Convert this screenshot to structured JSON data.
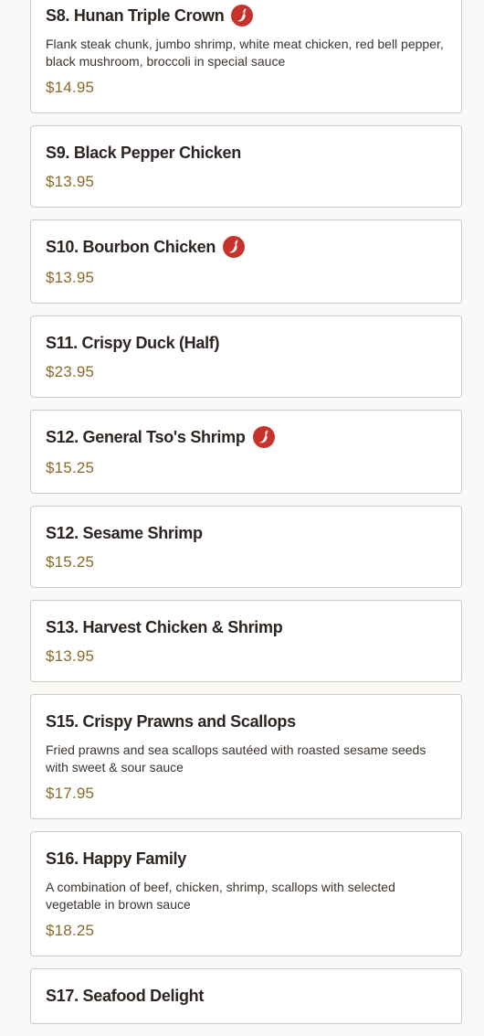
{
  "menu_items": [
    {
      "name": "S8. Hunan Triple Crown",
      "spicy": true,
      "description": "Flank steak chunk, jumbo shrimp, white meat chicken, red bell pepper, black mushroom, broccoli in special sauce",
      "price": "$14.95"
    },
    {
      "name": "S9. Black Pepper Chicken",
      "spicy": false,
      "description": "",
      "price": "$13.95"
    },
    {
      "name": "S10. Bourbon Chicken",
      "spicy": true,
      "description": "",
      "price": "$13.95"
    },
    {
      "name": "S11. Crispy Duck (Half)",
      "spicy": false,
      "description": "",
      "price": "$23.95"
    },
    {
      "name": "S12. General Tso's Shrimp",
      "spicy": true,
      "description": "",
      "price": "$15.25"
    },
    {
      "name": "S12. Sesame Shrimp",
      "spicy": false,
      "description": "",
      "price": "$15.25"
    },
    {
      "name": "S13. Harvest Chicken & Shrimp",
      "spicy": false,
      "description": "",
      "price": "$13.95"
    },
    {
      "name": "S15. Crispy Prawns and Scallops",
      "spicy": false,
      "description": "Fried prawns and sea scallops sautéed with roasted sesame seeds with sweet & sour sauce",
      "price": "$17.95"
    },
    {
      "name": "S16. Happy Family",
      "spicy": false,
      "description": "A combination of beef, chicken, shrimp, scallops with selected vegetable in brown sauce",
      "price": "$18.25"
    },
    {
      "name": "S17. Seafood Delight",
      "spicy": false,
      "description": "",
      "price": ""
    }
  ],
  "icons": {
    "spicy": "chili-pepper-icon"
  },
  "colors": {
    "spicy_icon": "#c7332c",
    "price": "#8a6a2a",
    "title": "#2d2521",
    "border": "#cfc9c2"
  }
}
